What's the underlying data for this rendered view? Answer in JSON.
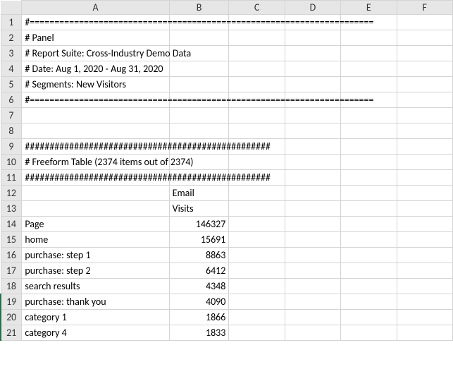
{
  "columns": [
    "A",
    "B",
    "C",
    "D",
    "E",
    "F"
  ],
  "row_numbers": [
    1,
    2,
    3,
    4,
    5,
    6,
    7,
    8,
    9,
    10,
    11,
    12,
    13,
    14,
    15,
    16,
    17,
    18,
    19,
    20,
    21
  ],
  "rows": {
    "r1": {
      "A": "#======================================================================"
    },
    "r2": {
      "A": "# Panel"
    },
    "r3": {
      "A": "# Report Suite: Cross-Industry Demo Data"
    },
    "r4": {
      "A": "# Date: Aug 1, 2020 - Aug 31, 2020"
    },
    "r5": {
      "A": "# Segments: New Visitors"
    },
    "r6": {
      "A": "#======================================================================"
    },
    "r7": {
      "A": ""
    },
    "r8": {
      "A": ""
    },
    "r9": {
      "A": "##################################################"
    },
    "r10": {
      "A": "# Freeform Table (2374 items out of 2374)"
    },
    "r11": {
      "A": "##################################################"
    },
    "r12": {
      "A": "",
      "B": "Email"
    },
    "r13": {
      "A": "",
      "B": "Visits"
    },
    "r14": {
      "A": "Page",
      "B": "146327"
    },
    "r15": {
      "A": "home",
      "B": "15691"
    },
    "r16": {
      "A": "purchase: step 1",
      "B": "8863"
    },
    "r17": {
      "A": "purchase: step 2",
      "B": "6412"
    },
    "r18": {
      "A": "search results",
      "B": "4348"
    },
    "r19": {
      "A": "purchase: thank you",
      "B": "4090"
    },
    "r20": {
      "A": "category 1",
      "B": "1866"
    },
    "r21": {
      "A": "category 4",
      "B": "1833"
    }
  },
  "chart_data": {
    "type": "table",
    "title": "Freeform Table (2374 items out of 2374)",
    "columns": [
      "Page",
      "Email Visits"
    ],
    "rows": [
      [
        "Page",
        146327
      ],
      [
        "home",
        15691
      ],
      [
        "purchase: step 1",
        8863
      ],
      [
        "purchase: step 2",
        6412
      ],
      [
        "search results",
        4348
      ],
      [
        "purchase: thank you",
        4090
      ],
      [
        "category 1",
        1866
      ],
      [
        "category 4",
        1833
      ]
    ]
  }
}
